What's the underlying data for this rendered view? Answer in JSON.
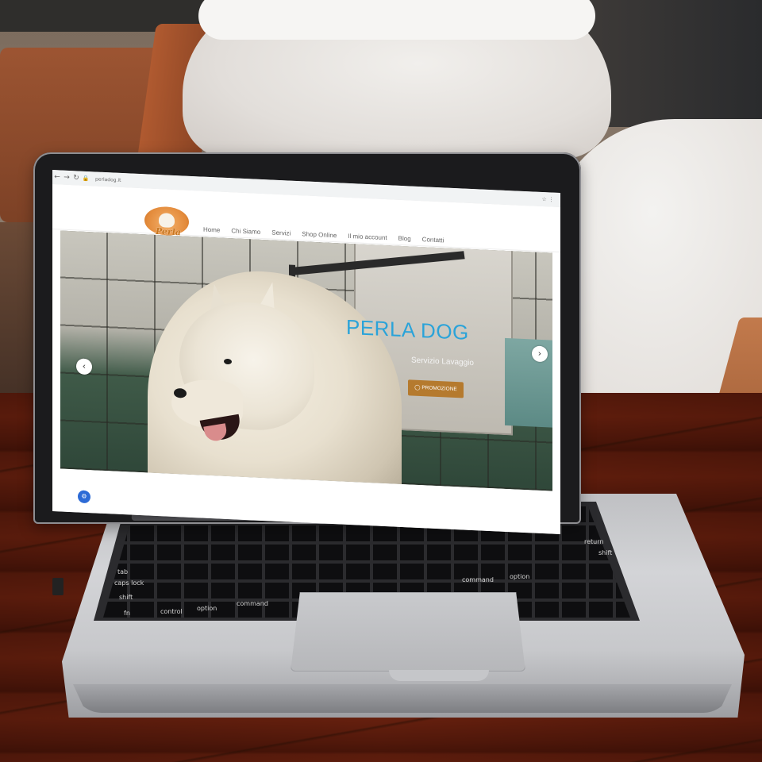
{
  "browser": {
    "url": "perladog.it",
    "back_icon": "arrow-left-icon",
    "forward_icon": "arrow-right-icon",
    "reload_icon": "reload-icon",
    "lock_icon": "lock-icon"
  },
  "site": {
    "logo_text": "Perla Dog",
    "menu": [
      {
        "label": "Home"
      },
      {
        "label": "Chi Siamo"
      },
      {
        "label": "Servizi"
      },
      {
        "label": "Shop Online"
      },
      {
        "label": "Il mio account"
      },
      {
        "label": "Blog"
      },
      {
        "label": "Contatti"
      }
    ]
  },
  "hero": {
    "title": "PERLA DOG",
    "subtitle": "Servizio Lavaggio",
    "button_label": "PROMOZIONE",
    "prev_arrow": "‹",
    "next_arrow": "›"
  },
  "widgets": {
    "cookie_icon": "cookie-icon"
  },
  "keyboard": {
    "tab": "tab",
    "caps": "caps lock",
    "shift": "shift",
    "fn": "fn",
    "control": "control",
    "option_left": "option",
    "command_left": "command",
    "command_right": "command",
    "option_right": "option",
    "return": "return",
    "shift_right": "shift"
  },
  "colors": {
    "hero_title": "#2aa3d9",
    "promo_button": "#b57a2e",
    "logo_text": "#c8761f"
  }
}
